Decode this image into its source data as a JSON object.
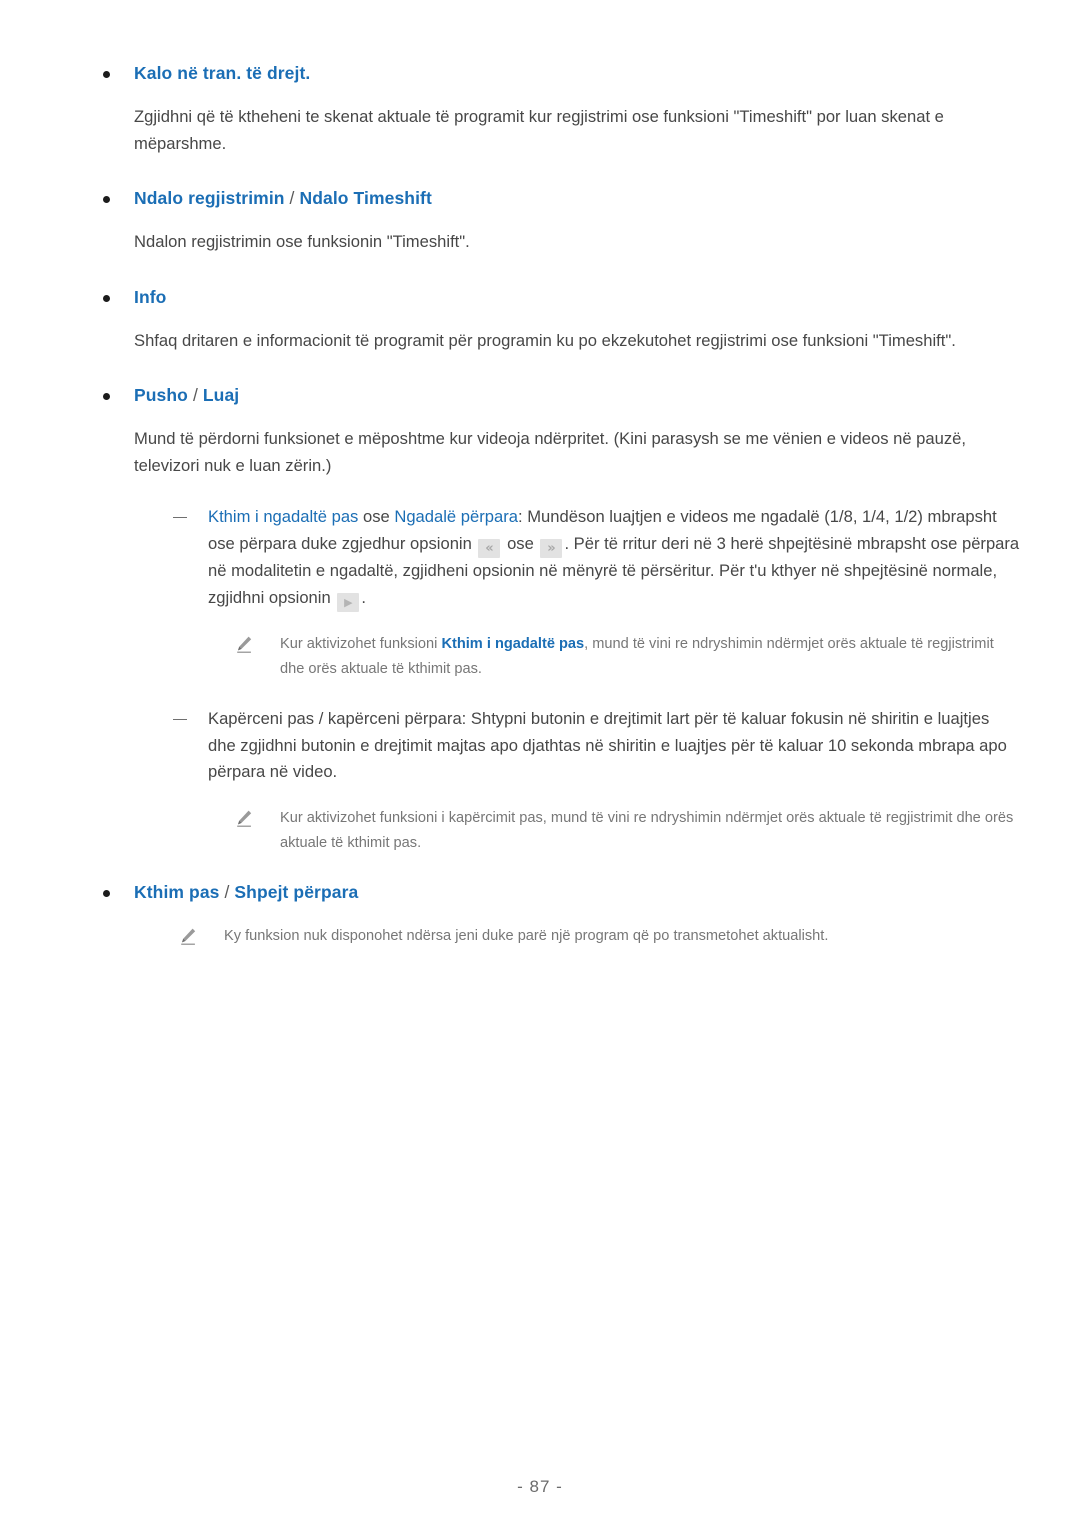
{
  "page": {
    "number_label": "- 87 -",
    "accent_blue": "#1b6eb5",
    "body_gray": "#474747",
    "note_gray": "#777777"
  },
  "sections": [
    {
      "heading": "Kalo në tran. të drejt.",
      "body": "Zgjidhni që të ktheheni te skenat aktuale të programit kur regjistrimi ose funksioni \"Timeshift\" por luan skenat e mëparshme."
    },
    {
      "heading_a": "Ndalo regjistrimin",
      "heading_sep": " / ",
      "heading_b": "Ndalo Timeshift",
      "body": "Ndalon regjistrimin ose funksionin \"Timeshift\"."
    },
    {
      "heading": "Info",
      "body": "Shfaq dritaren e informacionit të programit për programin ku po ekzekutohet regjistrimi ose funksioni \"Timeshift\"."
    },
    {
      "heading_a": "Pusho",
      "heading_sep": " / ",
      "heading_b": "Luaj",
      "body": "Mund të përdorni funksionet e mëposhtme kur videoja ndërpritet. (Kini parasysh se me vënien e videos në pauzë, televizori nuk e luan zërin.)"
    }
  ],
  "sub_items": [
    {
      "term_a": "Kthim i ngadaltë pas",
      "mid_a": " ose ",
      "term_b": "Ngadalë përpara",
      "text_1": ": Mundëson luajtjen e videos me ngadalë (1/8, 1/4, 1/2) mbrapsht ose përpara duke zgjedhur opsionin ",
      "icon_1": "rewind-icon",
      "icon_1_glyph": "«",
      "text_2": " ose ",
      "icon_2": "fast-forward-icon",
      "icon_2_glyph": "»",
      "text_3": ". Për të rritur deri në 3 herë shpejtësinë mbrapsht ose përpara në modalitetin e ngadaltë, zgjidheni opsionin në mënyrë të përsëritur. Për t'u kthyer në shpejtësinë normale, zgjidhni opsionin ",
      "icon_3": "play-icon",
      "icon_3_glyph": "▶",
      "text_4": "."
    },
    {
      "text": "Kapërceni pas / kapërceni përpara: Shtypni butonin e drejtimit lart për të kaluar fokusin në shiritin e luajtjes dhe zgjidhni butonin e drejtimit majtas apo djathtas në shiritin e luajtjes për të kaluar 10 sekonda mbrapa apo përpara në video."
    }
  ],
  "notes": [
    {
      "pre": "Kur aktivizohet funksioni ",
      "emph": "Kthim i ngadaltë pas",
      "post": ", mund të vini re ndryshimin ndërmjet orës aktuale të regjistrimit dhe orës aktuale të kthimit pas."
    },
    {
      "pre": "Kur aktivizohet funksioni i kapërcimit pas, mund të vini re ndryshimin ndërmjet orës aktuale të regjistrimit dhe orës aktuale të kthimit pas.",
      "emph": "",
      "post": ""
    },
    {
      "pre": "Ky funksion nuk disponohet ndërsa jeni duke parë një program që po transmetohet aktualisht.",
      "emph": "",
      "post": ""
    }
  ],
  "last_section": {
    "heading_a": "Kthim pas",
    "heading_sep": " / ",
    "heading_b": "Shpejt përpara"
  }
}
